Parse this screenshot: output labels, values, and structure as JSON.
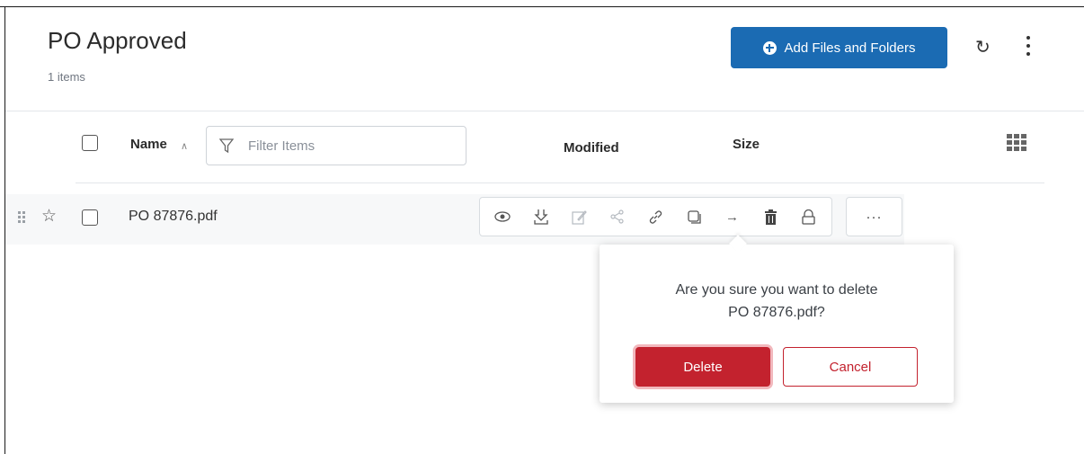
{
  "header": {
    "title": "PO Approved",
    "item_count": "1 items",
    "add_button_label": "Add Files and Folders",
    "refresh_icon": "refresh-icon",
    "more_icon": "kebab-menu-icon"
  },
  "table": {
    "columns": {
      "name": "Name",
      "modified": "Modified",
      "size": "Size"
    },
    "filter_placeholder": "Filter Items",
    "rows": [
      {
        "name": "PO 87876.pdf",
        "modified": "",
        "size": ""
      }
    ],
    "row_actions": [
      "view-icon",
      "download-icon",
      "edit-icon",
      "share-icon",
      "link-icon",
      "copy-icon",
      "move-icon",
      "trash-icon",
      "lock-icon"
    ],
    "more_label": "···"
  },
  "confirm_dialog": {
    "line1": "Are you sure you want to delete",
    "line2": "PO 87876.pdf?",
    "delete_label": "Delete",
    "cancel_label": "Cancel"
  },
  "colors": {
    "primary": "#1b6bb3",
    "danger": "#c3222e"
  }
}
